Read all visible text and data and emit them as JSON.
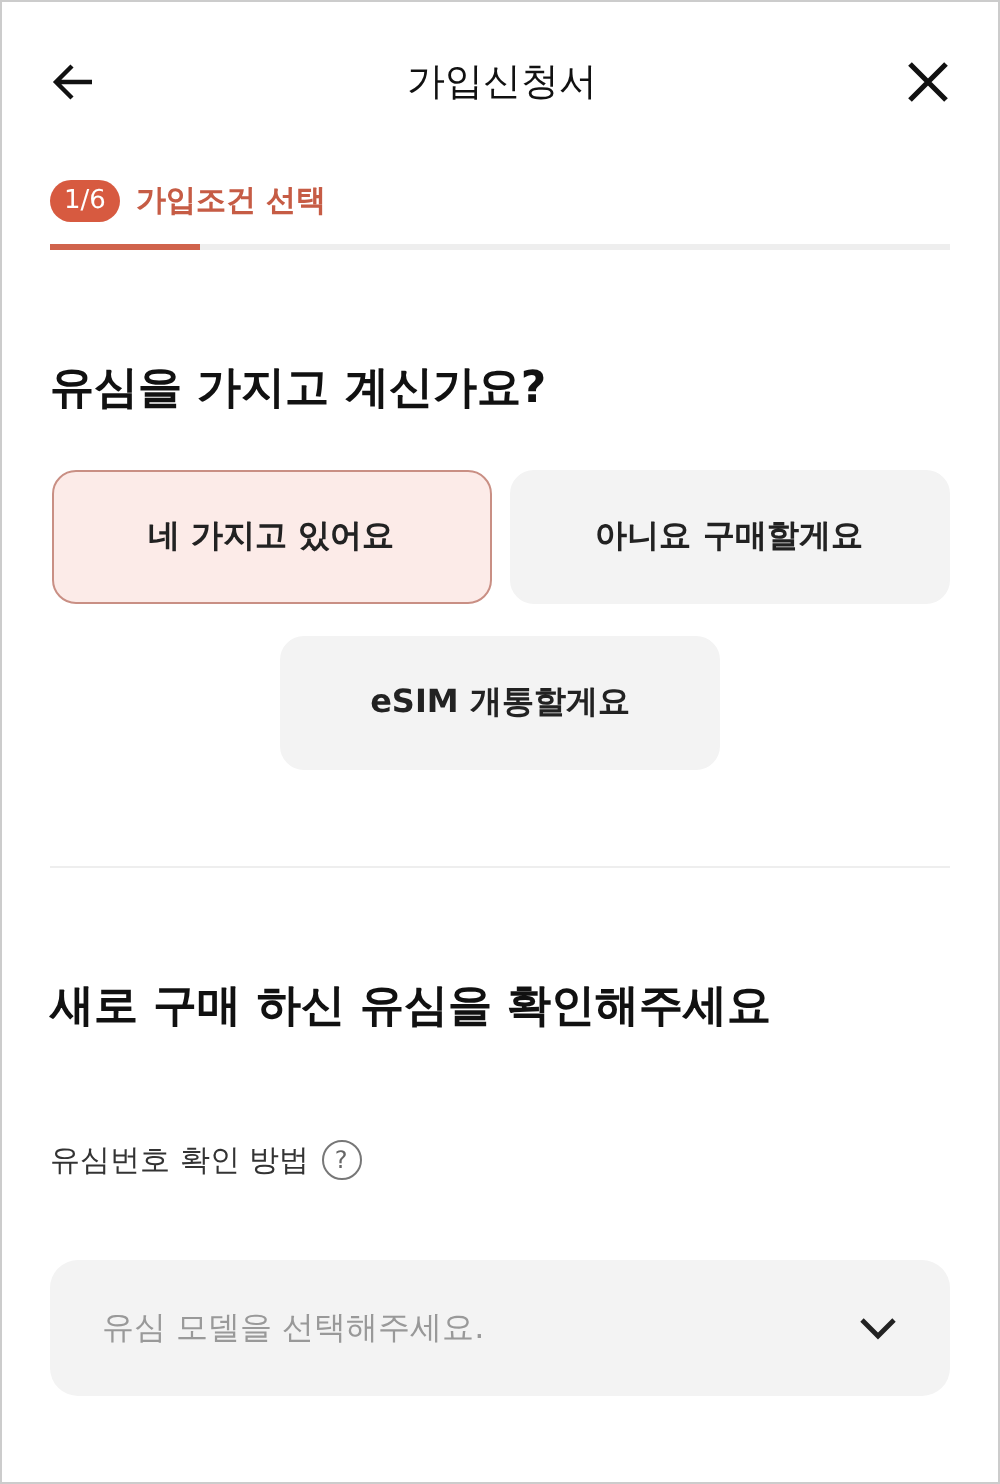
{
  "header": {
    "title": "가입신청서"
  },
  "step": {
    "badge": "1/6",
    "label": "가입조건 선택",
    "level": 0.167
  },
  "question": {
    "title": "유심을 가지고 계신가요?",
    "options": [
      {
        "label": "네 가지고 있어요",
        "selected": true
      },
      {
        "label": "아니요 구매할게요",
        "selected": false
      },
      {
        "label": "eSIM 개통할게요",
        "selected": false
      }
    ]
  },
  "sim_section": {
    "title": "새로 구매 하신 유심을 확인해주세요",
    "label": "유심번호 확인 방법",
    "help": "?",
    "dropdown": {
      "placeholder": "유심 모델을 선택해주세요."
    }
  }
}
